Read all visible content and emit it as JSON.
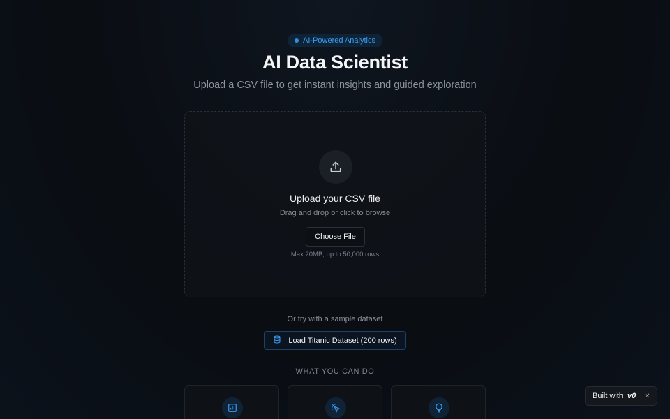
{
  "badge": {
    "text": "AI-Powered Analytics"
  },
  "header": {
    "title": "AI Data Scientist",
    "subtitle": "Upload a CSV file to get instant insights and guided exploration"
  },
  "dropzone": {
    "icon": "upload-icon",
    "title": "Upload your CSV file",
    "subtitle": "Drag and drop or click to browse",
    "button_label": "Choose File",
    "limit": "Max 20MB, up to 50,000 rows"
  },
  "sample": {
    "prompt": "Or try with a sample dataset",
    "icon": "database-icon",
    "button_label": "Load Titanic Dataset (200 rows)"
  },
  "features": {
    "label": "WHAT YOU CAN DO",
    "cards": [
      {
        "icon": "bar-chart-icon"
      },
      {
        "icon": "cursor-click-icon"
      },
      {
        "icon": "lightbulb-icon"
      }
    ]
  },
  "built_with": {
    "label": "Built with",
    "logo": "v0",
    "close_icon": "close-icon"
  },
  "colors": {
    "accent": "#2f8fe6",
    "background": "#0a0d12"
  }
}
